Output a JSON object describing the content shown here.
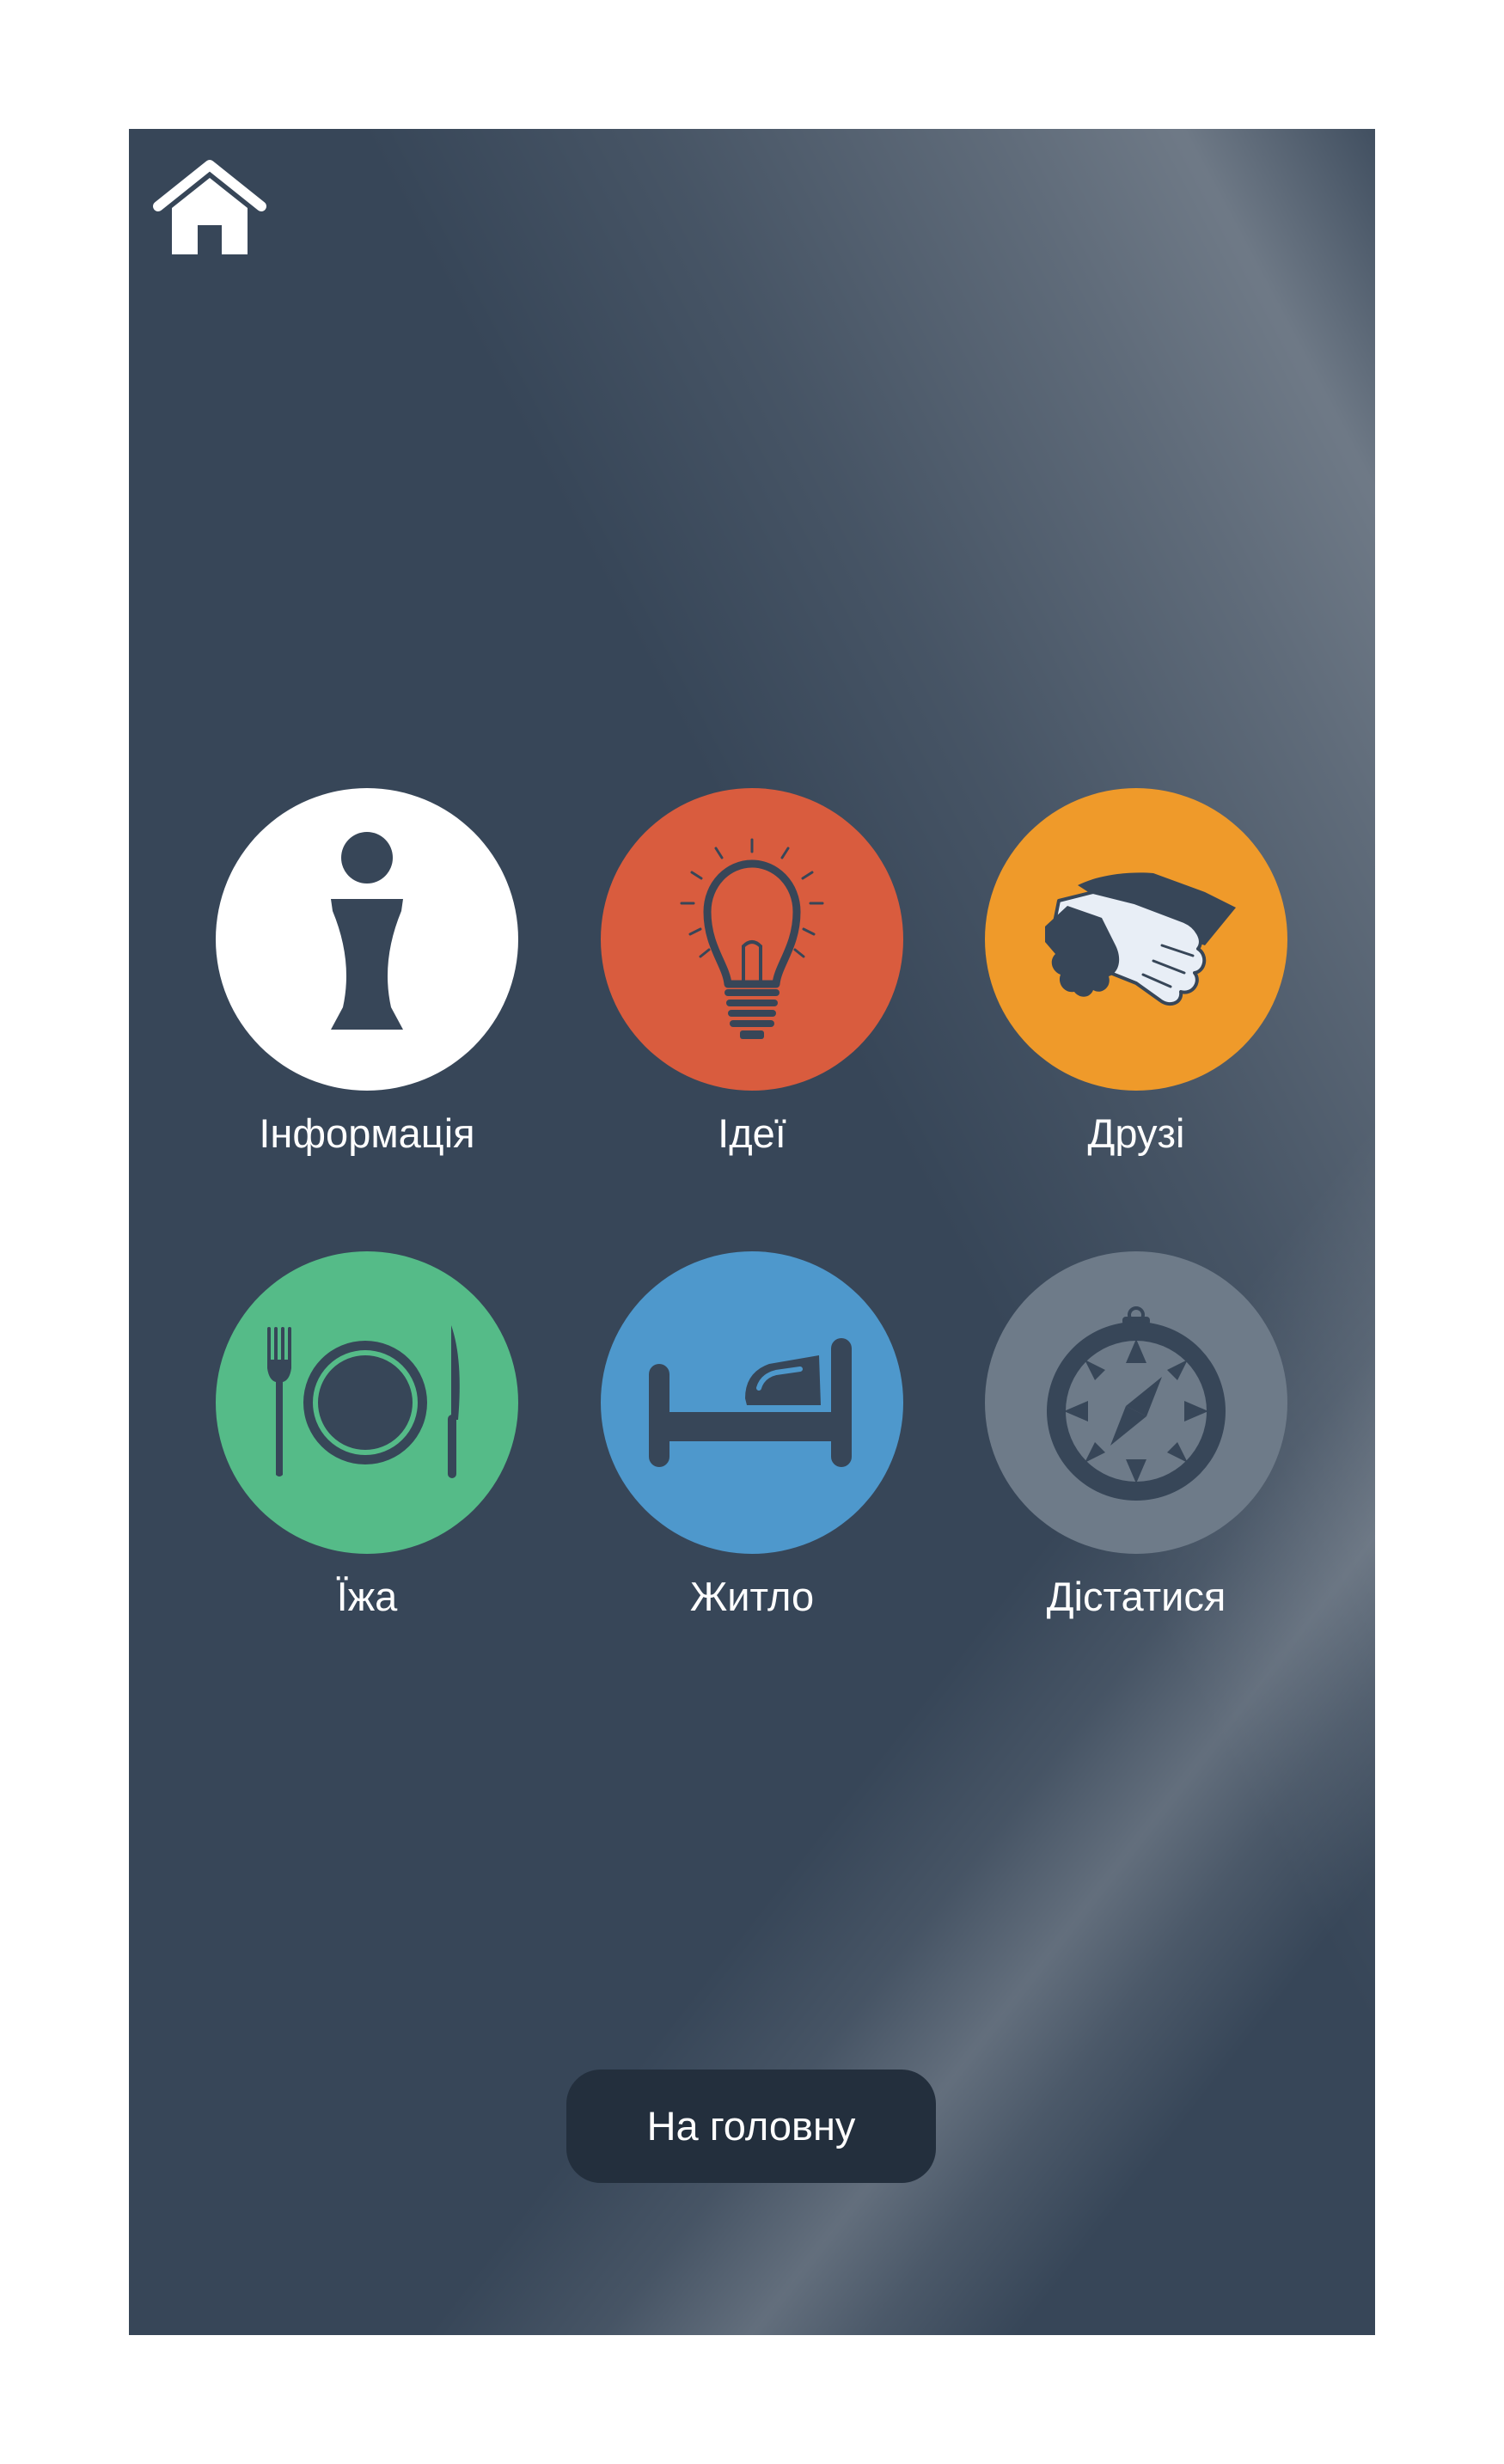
{
  "header": {
    "home_icon": "home-icon"
  },
  "tiles": [
    {
      "label": "Інформація",
      "icon": "info-icon",
      "color": "#ffffff"
    },
    {
      "label": "Ідеї",
      "icon": "lightbulb-icon",
      "color": "#d95c3e"
    },
    {
      "label": "Друзі",
      "icon": "handshake-icon",
      "color": "#ef9a2a"
    },
    {
      "label": "Їжа",
      "icon": "plate-cutlery-icon",
      "color": "#55bb88"
    },
    {
      "label": "Житло",
      "icon": "bed-icon",
      "color": "#4e98cc"
    },
    {
      "label": "Дістатися",
      "icon": "compass-icon",
      "color": "#6e7b89"
    }
  ],
  "footer": {
    "main_button_label": "На головну"
  },
  "colors": {
    "background": "#374658",
    "icon_dark": "#374658",
    "button_dark": "#232f3d"
  }
}
